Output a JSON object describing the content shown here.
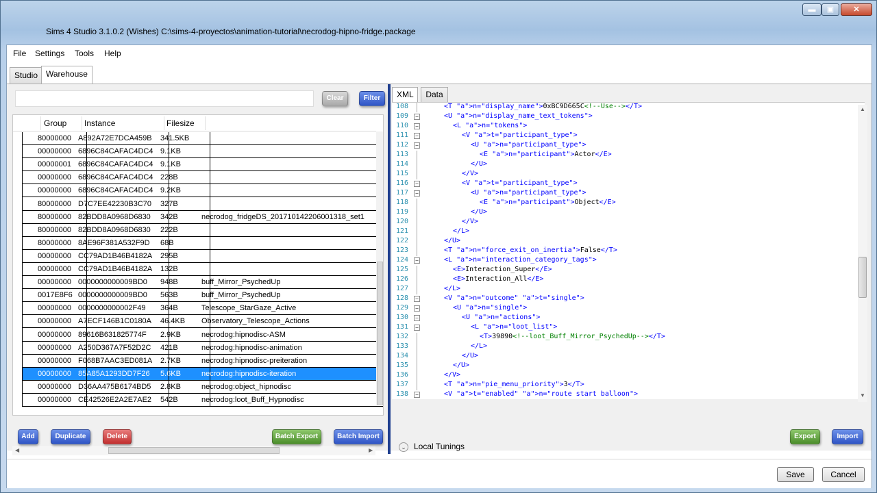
{
  "window": {
    "title": "Sims 4 Studio 3.1.0.2 (Wishes)  C:\\sims-4-proyectos\\animation-tutorial\\necrodog-hipno-fridge.package",
    "min_glyph": "▬",
    "max_glyph": "▣",
    "close_glyph": "✕"
  },
  "menu": {
    "file": "File",
    "settings": "Settings",
    "tools": "Tools",
    "help": "Help"
  },
  "tabs": {
    "studio": "Studio",
    "warehouse": "Warehouse"
  },
  "warehouse": {
    "search_value": "",
    "clear_label": "Clear",
    "filter_label": "Filter",
    "columns": {
      "group": "Group",
      "instance": "Instance",
      "filesize": "Filesize"
    },
    "rows": [
      {
        "group": "80000000",
        "instance": "A892A72E7DCA459B",
        "size": "341.5KB",
        "name": ""
      },
      {
        "group": "00000000",
        "instance": "6896C84CAFAC4DC4",
        "size": "9.1KB",
        "name": ""
      },
      {
        "group": "00000001",
        "instance": "6896C84CAFAC4DC4",
        "size": "9.1KB",
        "name": ""
      },
      {
        "group": "00000000",
        "instance": "6896C84CAFAC4DC4",
        "size": "228B",
        "name": ""
      },
      {
        "group": "00000000",
        "instance": "6896C84CAFAC4DC4",
        "size": "9.2KB",
        "name": ""
      },
      {
        "group": "80000000",
        "instance": "D7C7EE42230B3C70",
        "size": "327B",
        "name": ""
      },
      {
        "group": "80000000",
        "instance": "82BDD8A0968D6830",
        "size": "342B",
        "name": "necrodog_fridgeDS_201710142206001318_set1"
      },
      {
        "group": "80000000",
        "instance": "82BDD8A0968D6830",
        "size": "222B",
        "name": ""
      },
      {
        "group": "80000000",
        "instance": "8AE96F381A532F9D",
        "size": "68B",
        "name": ""
      },
      {
        "group": "00000000",
        "instance": "CC79AD1B46B4182A",
        "size": "295B",
        "name": ""
      },
      {
        "group": "00000000",
        "instance": "CC79AD1B46B4182A",
        "size": "132B",
        "name": ""
      },
      {
        "group": "00000000",
        "instance": "0000000000009BD0",
        "size": "948B",
        "name": "buff_Mirror_PsychedUp"
      },
      {
        "group": "0017E8F6",
        "instance": "0000000000009BD0",
        "size": "563B",
        "name": "buff_Mirror_PsychedUp"
      },
      {
        "group": "00000000",
        "instance": "0000000000002F49",
        "size": "364B",
        "name": "Telescope_StarGaze_Active"
      },
      {
        "group": "00000000",
        "instance": "A7ECF146B1C0180A",
        "size": "46.4KB",
        "name": "Observatory_Telescope_Actions"
      },
      {
        "group": "00000000",
        "instance": "89616B631825774F",
        "size": "2.9KB",
        "name": "necrodog:hipnodisc-ASM"
      },
      {
        "group": "00000000",
        "instance": "A250D367A7F52D2C",
        "size": "421B",
        "name": "necrodog:hipnodisc-animation"
      },
      {
        "group": "00000000",
        "instance": "F068B7AAC3ED081A",
        "size": "2.7KB",
        "name": "necrodog:hipnodisc-preiteration"
      },
      {
        "group": "00000000",
        "instance": "85A85A1293DD7F26",
        "size": "5.6KB",
        "name": "necrodog:hipnodisc-iteration"
      },
      {
        "group": "00000000",
        "instance": "D36AA475B6174BD5",
        "size": "2.8KB",
        "name": "necrodog:object_hipnodisc"
      },
      {
        "group": "00000000",
        "instance": "CE42526E2A2E7AE2",
        "size": "542B",
        "name": "necrodog:loot_Buff_Hypnodisc"
      }
    ],
    "selected_index": 18
  },
  "editor": {
    "tab_xml": "XML",
    "tab_data": "Data",
    "local_tunings": "Local Tunings",
    "lines": [
      {
        "n": "108",
        "i": 2,
        "f": "",
        "h": "<T n=\"display_name\">0xBC9D665C<!--Use--></T>"
      },
      {
        "n": "109",
        "i": 2,
        "f": "−",
        "h": "<U n=\"display_name_text_tokens\">"
      },
      {
        "n": "110",
        "i": 3,
        "f": "−",
        "h": "<L n=\"tokens\">"
      },
      {
        "n": "111",
        "i": 4,
        "f": "−",
        "h": "<V t=\"participant_type\">"
      },
      {
        "n": "112",
        "i": 5,
        "f": "−",
        "h": "<U n=\"participant_type\">"
      },
      {
        "n": "113",
        "i": 6,
        "f": "",
        "h": "<E n=\"participant\">Actor</E>"
      },
      {
        "n": "114",
        "i": 5,
        "f": "",
        "h": "</U>"
      },
      {
        "n": "115",
        "i": 4,
        "f": "",
        "h": "</V>"
      },
      {
        "n": "116",
        "i": 4,
        "f": "−",
        "h": "<V t=\"participant_type\">"
      },
      {
        "n": "117",
        "i": 5,
        "f": "−",
        "h": "<U n=\"participant_type\">"
      },
      {
        "n": "118",
        "i": 6,
        "f": "",
        "h": "<E n=\"participant\">Object</E>"
      },
      {
        "n": "119",
        "i": 5,
        "f": "",
        "h": "</U>"
      },
      {
        "n": "120",
        "i": 4,
        "f": "",
        "h": "</V>"
      },
      {
        "n": "121",
        "i": 3,
        "f": "",
        "h": "</L>"
      },
      {
        "n": "122",
        "i": 2,
        "f": "",
        "h": "</U>"
      },
      {
        "n": "123",
        "i": 2,
        "f": "",
        "h": "<T n=\"force_exit_on_inertia\">False</T>"
      },
      {
        "n": "124",
        "i": 2,
        "f": "−",
        "h": "<L n=\"interaction_category_tags\">"
      },
      {
        "n": "125",
        "i": 3,
        "f": "",
        "h": "<E>Interaction_Super</E>"
      },
      {
        "n": "126",
        "i": 3,
        "f": "",
        "h": "<E>Interaction_All</E>"
      },
      {
        "n": "127",
        "i": 2,
        "f": "",
        "h": "</L>"
      },
      {
        "n": "128",
        "i": 2,
        "f": "−",
        "h": "<V n=\"outcome\" t=\"single\">"
      },
      {
        "n": "129",
        "i": 3,
        "f": "−",
        "h": "<U n=\"single\">"
      },
      {
        "n": "130",
        "i": 4,
        "f": "−",
        "h": "<U n=\"actions\">"
      },
      {
        "n": "131",
        "i": 5,
        "f": "−",
        "h": "<L n=\"loot_list\">"
      },
      {
        "n": "132",
        "i": 6,
        "f": "",
        "h": "<T>39890<!--loot_Buff_Mirror_PsychedUp--></T>"
      },
      {
        "n": "133",
        "i": 5,
        "f": "",
        "h": "</L>"
      },
      {
        "n": "134",
        "i": 4,
        "f": "",
        "h": "</U>"
      },
      {
        "n": "135",
        "i": 3,
        "f": "",
        "h": "</U>"
      },
      {
        "n": "136",
        "i": 2,
        "f": "",
        "h": "</V>"
      },
      {
        "n": "137",
        "i": 2,
        "f": "",
        "h": "<T n=\"pie_menu_priority\">3</T>"
      },
      {
        "n": "138",
        "i": 2,
        "f": "−",
        "h": "<V t=\"enabled\" n=\"route start balloon\">"
      }
    ]
  },
  "actions": {
    "add": "Add",
    "duplicate": "Duplicate",
    "delete": "Delete",
    "batch_export": "Batch Export",
    "batch_import": "Batch Import",
    "export": "Export",
    "import": "Import"
  },
  "footer": {
    "save": "Save",
    "cancel": "Cancel"
  },
  "scroll": {
    "up": "▲",
    "down": "▼",
    "left": "◀",
    "right": "▶",
    "fold_circle": "⌄"
  }
}
